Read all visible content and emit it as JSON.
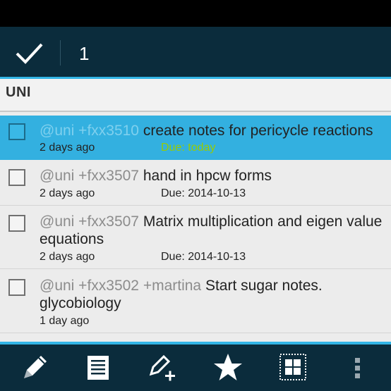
{
  "action_bar": {
    "selected_count": "1"
  },
  "list": {
    "header": "UNI"
  },
  "tasks": [
    {
      "tags": "@uni +fxx3510",
      "text": "create notes for pericycle reactions",
      "created": "2 days ago",
      "due": "Due: today",
      "selected": true
    },
    {
      "tags": "@uni +fxx3507",
      "text": "hand in hpcw forms",
      "created": "2 days ago",
      "due": "Due: 2014-10-13",
      "selected": false
    },
    {
      "tags": "@uni +fxx3507",
      "text": "Matrix multiplication and eigen value equations",
      "created": "2 days ago",
      "due": "Due: 2014-10-13",
      "selected": false
    },
    {
      "tags": "@uni +fxx3502 +martina",
      "text": "Start sugar notes. glycobiology",
      "created": "1 day ago",
      "due": "",
      "selected": false
    }
  ],
  "bottom_bar": {
    "icons": [
      "pencil-icon",
      "list-icon",
      "add-task-icon",
      "star-icon",
      "select-all-icon",
      "overflow-menu-icon"
    ]
  },
  "colors": {
    "accent": "#33b5e5",
    "bar": "#0b2c3c",
    "due_today": "#99cc00"
  }
}
